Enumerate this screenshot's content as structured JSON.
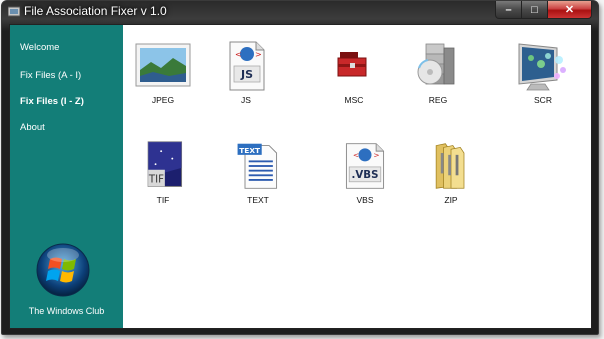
{
  "window": {
    "title": "File Association Fixer v 1.0"
  },
  "caption": {
    "minimize": "–",
    "maximize": "□",
    "close": "✕"
  },
  "sidebar": {
    "items": [
      {
        "label": "Welcome",
        "active": false
      },
      {
        "label": "Fix Files (A - I)",
        "active": false
      },
      {
        "label": "Fix Files (I - Z)",
        "active": true
      },
      {
        "label": "About",
        "active": false
      }
    ],
    "brand": "The Windows Club",
    "color": "#137e78"
  },
  "files": [
    {
      "label": "JPEG",
      "icon": "jpeg-image-icon"
    },
    {
      "label": "JS",
      "icon": "js-script-icon"
    },
    {
      "label": "MSC",
      "icon": "toolbox-icon"
    },
    {
      "label": "REG",
      "icon": "registry-icon"
    },
    {
      "label": "SCR",
      "icon": "screensaver-icon"
    },
    {
      "label": "TIF",
      "icon": "tif-image-icon"
    },
    {
      "label": "TEXT",
      "icon": "text-document-icon"
    },
    {
      "label": "VBS",
      "icon": "vbs-script-icon"
    },
    {
      "label": "ZIP",
      "icon": "zip-folder-icon"
    }
  ],
  "icon_text": {
    "js": "JS",
    "tif": "TIF",
    "text": "TEXT",
    "vbs": ".VBS"
  }
}
